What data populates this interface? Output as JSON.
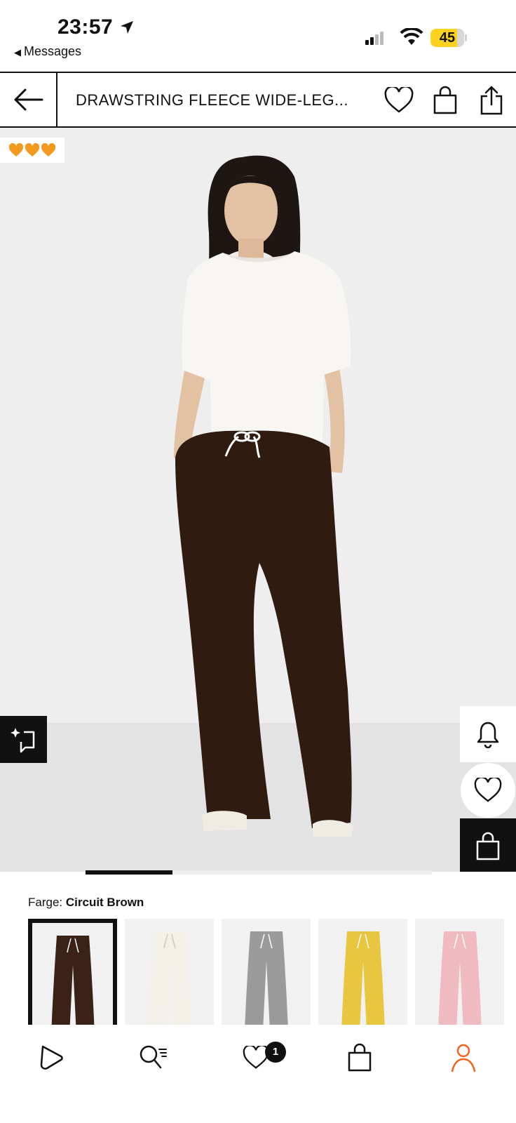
{
  "status_bar": {
    "time": "23:57",
    "back_app": "Messages",
    "battery": "45"
  },
  "header": {
    "title": "DRAWSTRING FLEECE WIDE-LEG..."
  },
  "product": {
    "badge_icons": [
      "orange-heart-icon",
      "orange-heart-icon",
      "orange-heart-icon"
    ],
    "gallery_progress": 0.25,
    "color_label": "Farge:",
    "color_value": "Circuit Brown",
    "swatches": [
      {
        "name": "brown",
        "color": "#3a2316",
        "selected": true
      },
      {
        "name": "white",
        "color": "#f3f0e8",
        "selected": false
      },
      {
        "name": "grey",
        "color": "#9b9b9b",
        "selected": false
      },
      {
        "name": "yellow",
        "color": "#e9c640",
        "selected": false
      },
      {
        "name": "pink",
        "color": "#efbac0",
        "selected": false
      }
    ]
  },
  "tabbar": {
    "wishlist_count": "1",
    "active_tab": "profile",
    "accent_color": "#f0641e"
  }
}
